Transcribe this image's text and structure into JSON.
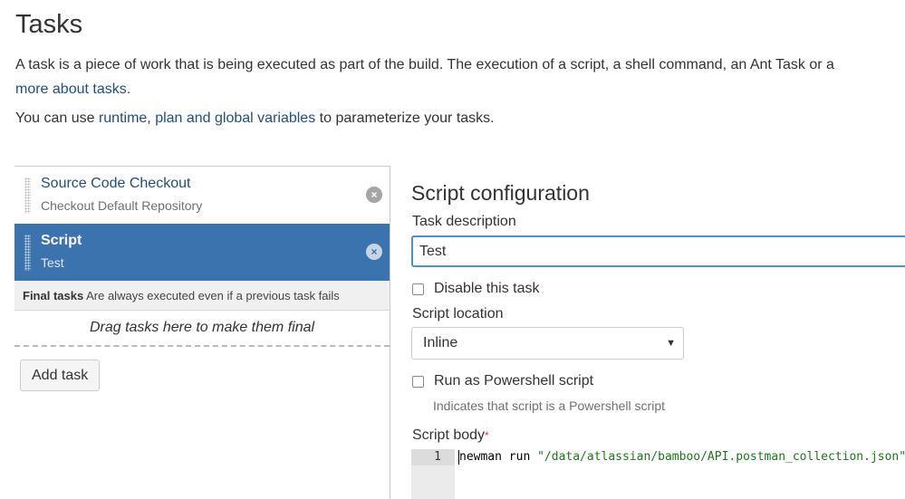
{
  "page": {
    "title": "Tasks",
    "intro_text": "A task is a piece of work that is being executed as part of the build. The execution of a script, a shell command, an Ant Task or a",
    "intro_link": "more about tasks.",
    "vars_prefix": "You can use ",
    "vars_link_runtime": "runtime",
    "vars_sep": ", ",
    "vars_link_plan": "plan and global variables",
    "vars_suffix": " to parameterize your tasks."
  },
  "tasks": {
    "items": [
      {
        "name": "Source Code Checkout",
        "description": "Checkout Default Repository",
        "selected": false
      },
      {
        "name": "Script",
        "description": "Test",
        "selected": true
      }
    ],
    "remove_icon": "×",
    "final_label": "Final tasks",
    "final_hint": "Are always executed even if a previous task fails",
    "drop_zone_text": "Drag tasks here to make them final",
    "add_task_label": "Add task"
  },
  "config": {
    "title": "Script configuration",
    "task_description_label": "Task description",
    "task_description_value": "Test",
    "disable_label": "Disable this task",
    "script_location_label": "Script location",
    "script_location_value": "Inline",
    "caret_icon": "▼",
    "powershell_label": "Run as Powershell script",
    "powershell_hint": "Indicates that script is a Powershell script",
    "script_body_label": "Script body",
    "required_marker": "*",
    "code": {
      "line_number": "1",
      "command": "newman run ",
      "argument": "\"/data/atlassian/bamboo/API.postman_collection.json\""
    }
  },
  "colors": {
    "link": "#205081",
    "selected_bg": "#3b73af",
    "focus_border": "#4a90d9",
    "required": "#d04437",
    "code_string": "#1a7a1a"
  }
}
